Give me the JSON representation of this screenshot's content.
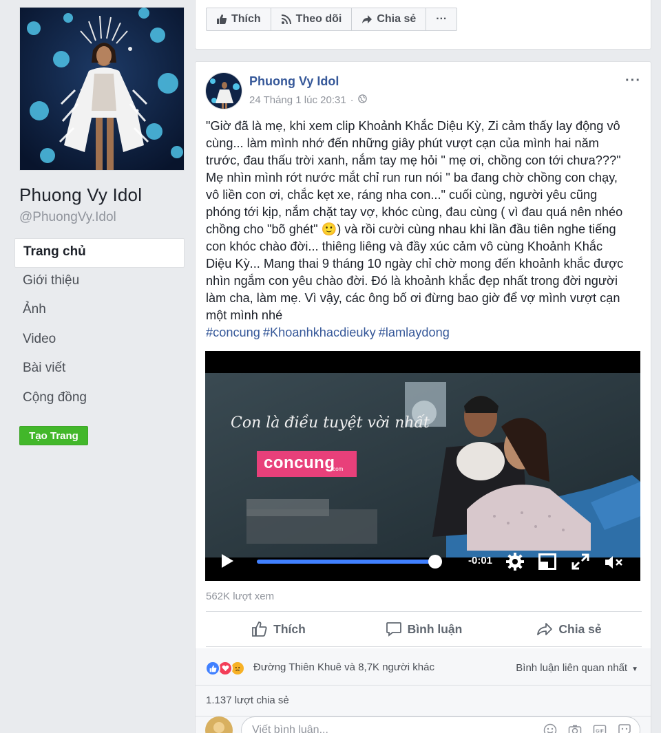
{
  "page": {
    "name": "Phuong Vy Idol",
    "handle": "@PhuongVy.Idol",
    "nav": [
      "Trang chủ",
      "Giới thiệu",
      "Ảnh",
      "Video",
      "Bài viết",
      "Cộng đồng"
    ],
    "create_page": "Tạo Trang"
  },
  "top_actions": {
    "like": "Thích",
    "follow": "Theo dõi",
    "share": "Chia sẻ",
    "more": "···"
  },
  "post": {
    "author": "Phuong Vy Idol",
    "timestamp": "24 Tháng 1 lúc 20:31",
    "privacy_icon": "globe-icon",
    "more": "···",
    "text_lines": [
      "\"Giờ đã là mẹ, khi xem clip Khoảnh Khắc Diệu Kỳ, Zi cảm thấy lay động vô",
      "cùng... làm mình nhớ đến những giây phút vượt cạn của mình hai năm",
      "trước, đau thấu trời xanh, nắm tay mẹ hỏi \" mẹ ơi, chồng con tới chưa???\"",
      "Mẹ nhìn mình rớt nước mắt chỉ run run nói \" ba đang chờ chồng con chạy,",
      "vô liền con ơi, chắc kẹt xe, ráng nha con...\" cuối cùng, người yêu cũng",
      "phóng tới kịp, nắm chặt tay vợ, khóc cùng, đau cùng ( vì đau quá nên nhéo",
      "chồng cho \"bõ ghét\" 🙂) và rồi cười cùng nhau khi lần đầu tiên nghe tiếng",
      "con khóc chào đời... thiêng liêng và đầy xúc cảm vô cùng Khoảnh Khắc",
      "Diệu Kỳ... Mang thai 9 tháng 10 ngày chỉ chờ mong đến khoảnh khắc được",
      "nhìn ngắm con yêu chào đời. Đó là khoảnh khắc đẹp nhất trong đời người",
      "làm cha, làm mẹ. Vì vậy, các ông bố ơi đừng bao giờ để vợ mình vượt cạn",
      "một mình nhé"
    ],
    "hashtags": [
      "#concung",
      "#Khoanhkhacdieuky",
      "#lamlaydong"
    ],
    "video": {
      "overlay_text": "Con là điều tuyệt vời nhất",
      "logo_text": "concung",
      "logo_sub": ".com",
      "time": "-0:01",
      "progress": 0.99
    },
    "views": "562K lượt xem",
    "actions": {
      "like": "Thích",
      "comment": "Bình luận",
      "share": "Chia sẻ"
    },
    "reactions_text": "Đường Thiên Khuê và 8,7K người khác",
    "comment_sort": "Bình luận liên quan nhất",
    "shares": "1.137 lượt chia sẻ",
    "comment_placeholder": "Viết bình luận..."
  },
  "colors": {
    "link_blue": "#365899",
    "green_button": "#42b72a",
    "progress_blue": "#4080ff",
    "brand_pink": "#e8407a"
  }
}
